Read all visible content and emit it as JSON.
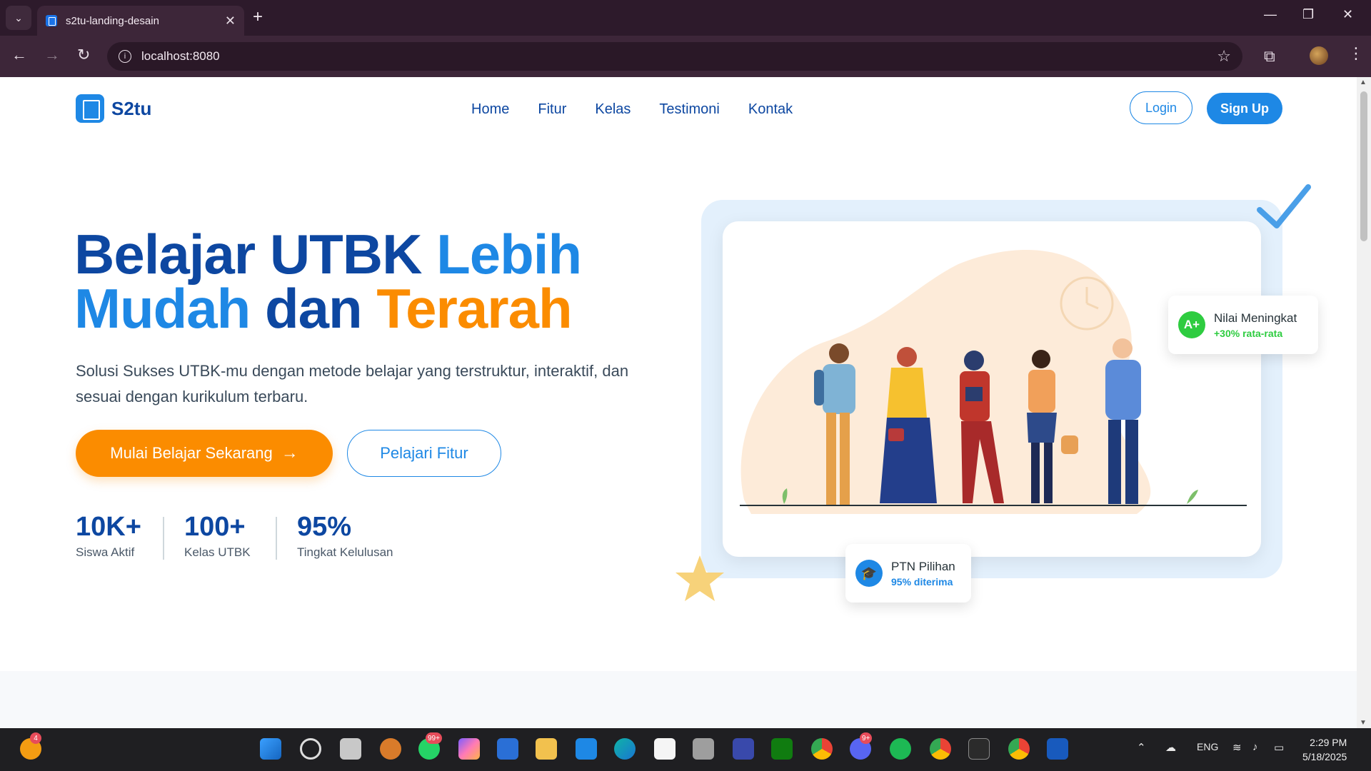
{
  "browser": {
    "tab_title": "s2tu-landing-desain",
    "tab_close": "✕",
    "new_tab": "+",
    "url": "localhost:8080",
    "window_min": "—",
    "window_restore": "❐",
    "window_close": "✕"
  },
  "site": {
    "logo_name": "S2tu",
    "nav": [
      "Home",
      "Fitur",
      "Kelas",
      "Testimoni",
      "Kontak"
    ],
    "login": "Login",
    "signup": "Sign Up"
  },
  "hero": {
    "title_line1_a": "Belajar UTBK ",
    "title_line1_b": "Lebih",
    "title_line2_a": "Mudah ",
    "title_line2_b": "dan ",
    "title_line2_c": "Terarah",
    "subtitle": "Solusi Sukses UTBK-mu dengan metode belajar yang terstruktur, interaktif, dan sesuai dengan kurikulum terbaru.",
    "cta_primary": "Mulai Belajar Sekarang",
    "cta_primary_arrow": "→",
    "cta_secondary": "Pelajari Fitur",
    "stats": [
      {
        "value": "10K+",
        "label": "Siswa Aktif"
      },
      {
        "value": "100+",
        "label": "Kelas UTBK"
      },
      {
        "value": "95%",
        "label": "Tingkat Kelulusan"
      }
    ]
  },
  "badges": {
    "grade": {
      "icon": "A+",
      "title": "Nilai Meningkat",
      "detail": "+30% rata-rata"
    },
    "ptn": {
      "icon": "🎓",
      "title": "PTN Pilihan",
      "detail": "95% diterima"
    }
  },
  "taskbar": {
    "badge_left": "4",
    "badge_whatsapp": "99+",
    "badge_discord": "9+",
    "lang": "ENG",
    "time": "2:29 PM",
    "date": "5/18/2025"
  },
  "colors": {
    "brand_dark": "#0d47a1",
    "brand_blue": "#1e88e5",
    "brand_orange": "#fb8c00",
    "accent_green": "#2ecc40"
  }
}
